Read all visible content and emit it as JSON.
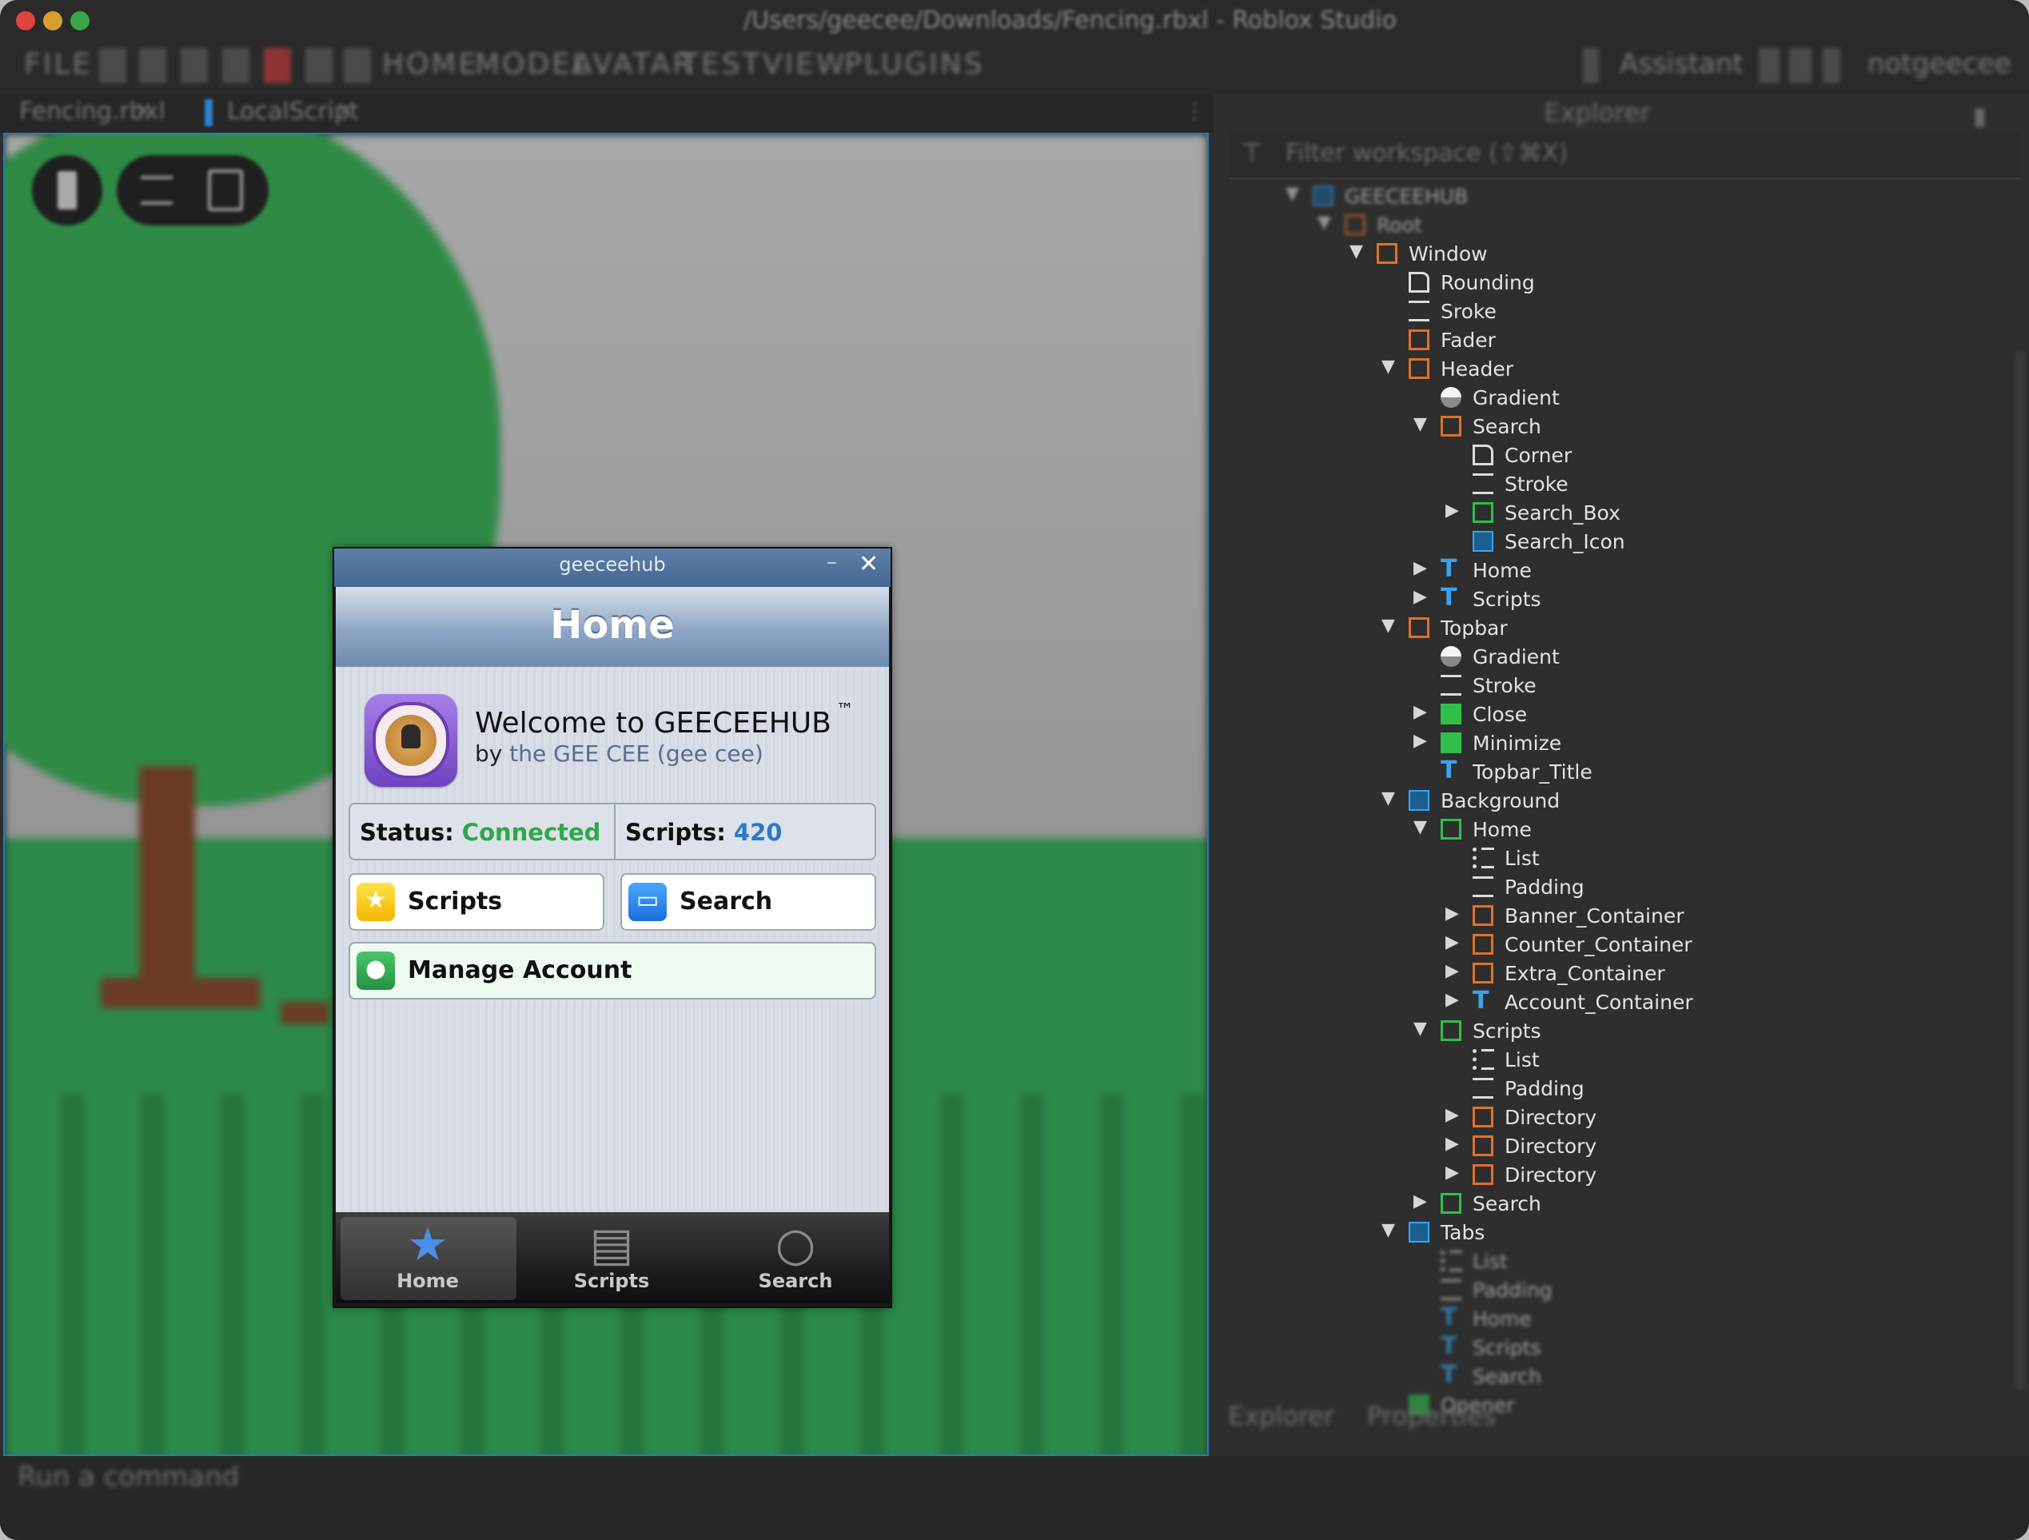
{
  "window": {
    "title": "/Users/geecee/Downloads/Fencing.rbxl - Roblox Studio"
  },
  "menu": [
    "FILE",
    "HOME",
    "MODEL",
    "AVATAR",
    "TEST",
    "VIEW",
    "PLUGINS"
  ],
  "toolbar_right": {
    "assistant": "Assistant",
    "user": "notgeecee"
  },
  "tabs": [
    {
      "label": "Fencing.rbxl"
    },
    {
      "label": "LocalScript"
    }
  ],
  "gui": {
    "window_title": "geeceehub",
    "minimize_glyph": "–",
    "close_glyph": "✕",
    "header_title": "Home",
    "welcome": "Welcome to GEECEEHUB",
    "trademark": "™",
    "by_prefix": "by",
    "author": "the GEE CEE (gee cee)",
    "status_label": "Status:",
    "status_value": "Connected",
    "scripts_label": "Scripts:",
    "scripts_value": "420",
    "buttons": {
      "scripts": "Scripts",
      "search": "Search",
      "manage": "Manage Account"
    },
    "tabbar": [
      {
        "label": "Home",
        "icon": "star-icon"
      },
      {
        "label": "Scripts",
        "icon": "archive-icon"
      },
      {
        "label": "Search",
        "icon": "magnifier-icon"
      }
    ],
    "colors": {
      "connected": "#2ea84a",
      "count": "#2e7ac4",
      "header": "#6f8bb0"
    }
  },
  "explorer": {
    "title": "Explorer",
    "filter_placeholder": "Filter workspace (⇧⌘X)",
    "tree": [
      {
        "label": "GEECEEHUB",
        "icon": "screen-gui-icon",
        "expanded": true
      },
      {
        "label": "Root",
        "icon": "frame-icon",
        "expanded": true
      },
      {
        "label": "Window",
        "icon": "frame-icon",
        "expanded": true
      },
      {
        "label": "Rounding",
        "icon": "corner-icon"
      },
      {
        "label": "Sroke",
        "icon": "stroke-icon"
      },
      {
        "label": "Fader",
        "icon": "frame-icon"
      },
      {
        "label": "Header",
        "icon": "frame-icon",
        "expanded": true
      },
      {
        "label": "Gradient",
        "icon": "gradient-icon"
      },
      {
        "label": "Search",
        "icon": "frame-icon",
        "expanded": true
      },
      {
        "label": "Corner",
        "icon": "corner-icon"
      },
      {
        "label": "Stroke",
        "icon": "stroke-icon"
      },
      {
        "label": "Search_Box",
        "icon": "scrolling-frame-icon",
        "expanded": false
      },
      {
        "label": "Search_Icon",
        "icon": "image-label-icon"
      },
      {
        "label": "Home",
        "icon": "text-button-icon",
        "expanded": false
      },
      {
        "label": "Scripts",
        "icon": "text-button-icon",
        "expanded": false
      },
      {
        "label": "Topbar",
        "icon": "frame-icon",
        "expanded": true
      },
      {
        "label": "Gradient",
        "icon": "gradient-icon"
      },
      {
        "label": "Stroke",
        "icon": "stroke-icon"
      },
      {
        "label": "Close",
        "icon": "image-button-icon",
        "expanded": false
      },
      {
        "label": "Minimize",
        "icon": "image-button-icon",
        "expanded": false
      },
      {
        "label": "Topbar_Title",
        "icon": "text-label-icon"
      },
      {
        "label": "Background",
        "icon": "image-label-icon",
        "expanded": true
      },
      {
        "label": "Home",
        "icon": "scrolling-frame-icon",
        "expanded": true
      },
      {
        "label": "List",
        "icon": "list-layout-icon"
      },
      {
        "label": "Padding",
        "icon": "padding-icon"
      },
      {
        "label": "Banner_Container",
        "icon": "frame-icon",
        "expanded": false
      },
      {
        "label": "Counter_Container",
        "icon": "frame-icon",
        "expanded": false
      },
      {
        "label": "Extra_Container",
        "icon": "frame-icon",
        "expanded": false
      },
      {
        "label": "Account_Container",
        "icon": "text-button-icon",
        "expanded": false
      },
      {
        "label": "Scripts",
        "icon": "scrolling-frame-icon",
        "expanded": true
      },
      {
        "label": "List",
        "icon": "list-layout-icon"
      },
      {
        "label": "Padding",
        "icon": "padding-icon"
      },
      {
        "label": "Directory",
        "icon": "frame-icon",
        "expanded": false
      },
      {
        "label": "Directory",
        "icon": "frame-icon",
        "expanded": false
      },
      {
        "label": "Directory",
        "icon": "frame-icon",
        "expanded": false
      },
      {
        "label": "Search",
        "icon": "scrolling-frame-icon",
        "expanded": false
      },
      {
        "label": "Tabs",
        "icon": "image-label-icon",
        "expanded": true
      },
      {
        "label": "List",
        "icon": "list-layout-icon"
      },
      {
        "label": "Padding",
        "icon": "padding-icon"
      },
      {
        "label": "Home",
        "icon": "text-button-icon"
      },
      {
        "label": "Scripts",
        "icon": "text-button-icon"
      },
      {
        "label": "Search",
        "icon": "text-button-icon"
      },
      {
        "label": "Opener",
        "icon": "image-button-icon"
      }
    ],
    "footer_tabs": [
      "Explorer",
      "Properties"
    ]
  },
  "command_bar": {
    "label": "Run a command"
  }
}
